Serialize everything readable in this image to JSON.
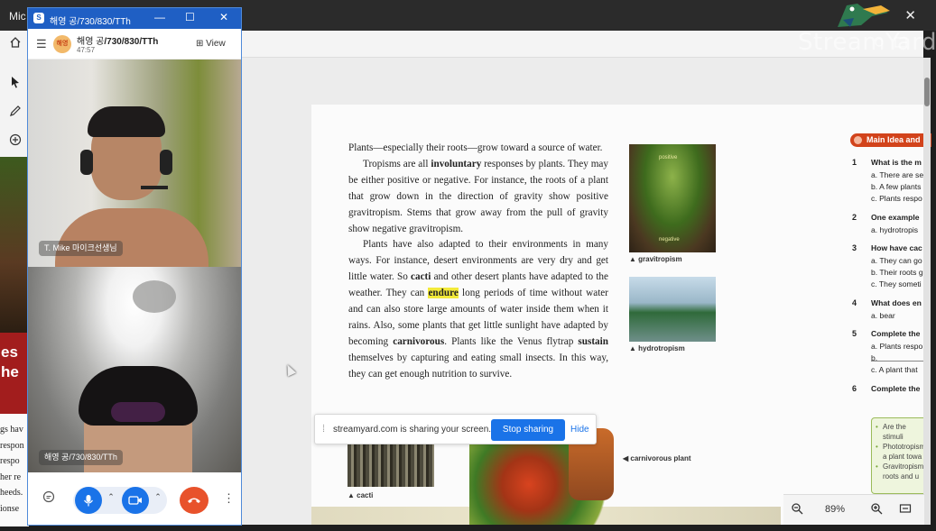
{
  "window": {
    "title": "Mic",
    "close_glyph": "✕"
  },
  "watermark": "StreamYard",
  "left_toolbar": {
    "icons": [
      "home-icon",
      "select-arrow-icon",
      "pen-icon",
      "add-circle-icon"
    ]
  },
  "left_thumb": {
    "red_text": [
      "es",
      "he"
    ],
    "snippets": [
      "gs hav",
      "respon",
      "respo",
      "her re",
      "heeds.",
      "ionse"
    ]
  },
  "call": {
    "titlebar_title": "해영 공/730/830/TTh",
    "chat_name_prefix": "해영 공",
    "chat_name_bold": "/730/830/TTh",
    "avatar_text": "해영",
    "duration": "47:57",
    "view_label": "View",
    "participant1_name": "T. Mike 마이크선생님",
    "participant2_name": "해영 공/730/830/TTh"
  },
  "page": {
    "paragraph1": "Plants—especially their roots—grow toward a source of water.",
    "p2_a": "Tropisms are all ",
    "p2_b": "involuntary",
    "p2_c": " responses by plants. They may be either positive or negative. For instance, the roots of a plant that grow down in the direction of gravity show positive gravitropism. Stems that grow away from the pull of gravity show negative gravitropism.",
    "p3_a": "Plants have also adapted to their environments in many ways. For instance, desert environments are very dry and get little water. So ",
    "p3_b": "cacti",
    "p3_c": " and other desert plants have adapted to the weather. They can ",
    "p3_d": "endure",
    "p3_e": " long periods of time without water and can also store large amounts of water inside them when it rains. Also, some plants that get little sunlight have adapted by becoming ",
    "p3_f": "carnivorous",
    "p3_g": ". Plants like the Venus flytrap ",
    "p3_h": "sustain",
    "p3_i": " themselves by capturing and eating small insects. In this way, they can get enough nutrition to survive.",
    "img1_top_label": "positive",
    "img1_bottom_label": "negative",
    "caption_gravitropism": "▲ gravitropism",
    "caption_hydrotropism": "▲ hydrotropism",
    "caption_cacti": "▲ cacti",
    "caption_carnivorous": "◀ carnivorous plant"
  },
  "main_idea": {
    "badge": "Main Idea and",
    "questions": [
      {
        "num": "1",
        "head": "What is the m",
        "opts": [
          "a. There are se",
          "b. A few plants",
          "c. Plants respo"
        ]
      },
      {
        "num": "2",
        "head": "One example",
        "opts": [
          "a. hydrotropis"
        ]
      },
      {
        "num": "3",
        "head": "How have cac",
        "opts": [
          "a. They can go",
          "b. Their roots g",
          "c. They someti"
        ]
      },
      {
        "num": "4",
        "head": "What does en",
        "opts": [
          "a. bear"
        ]
      },
      {
        "num": "5",
        "head": "Complete the",
        "opts": [
          "a. Plants respo",
          "b.",
          "c. A plant that"
        ]
      },
      {
        "num": "6",
        "head": "Complete the",
        "opts": []
      }
    ],
    "summary_items": [
      "Are the stimuli",
      "Phototropism a plant towa",
      "Gravitropism roots and u"
    ]
  },
  "zoom": {
    "value": "89%",
    "zoom_out_icon": "zoom-out-icon",
    "zoom_in_icon": "zoom-in-icon",
    "fit_icon": "fit-page-icon"
  },
  "share_bar": {
    "message": "streamyard.com is sharing your screen.",
    "stop_label": "Stop sharing",
    "hide_label": "Hide"
  }
}
